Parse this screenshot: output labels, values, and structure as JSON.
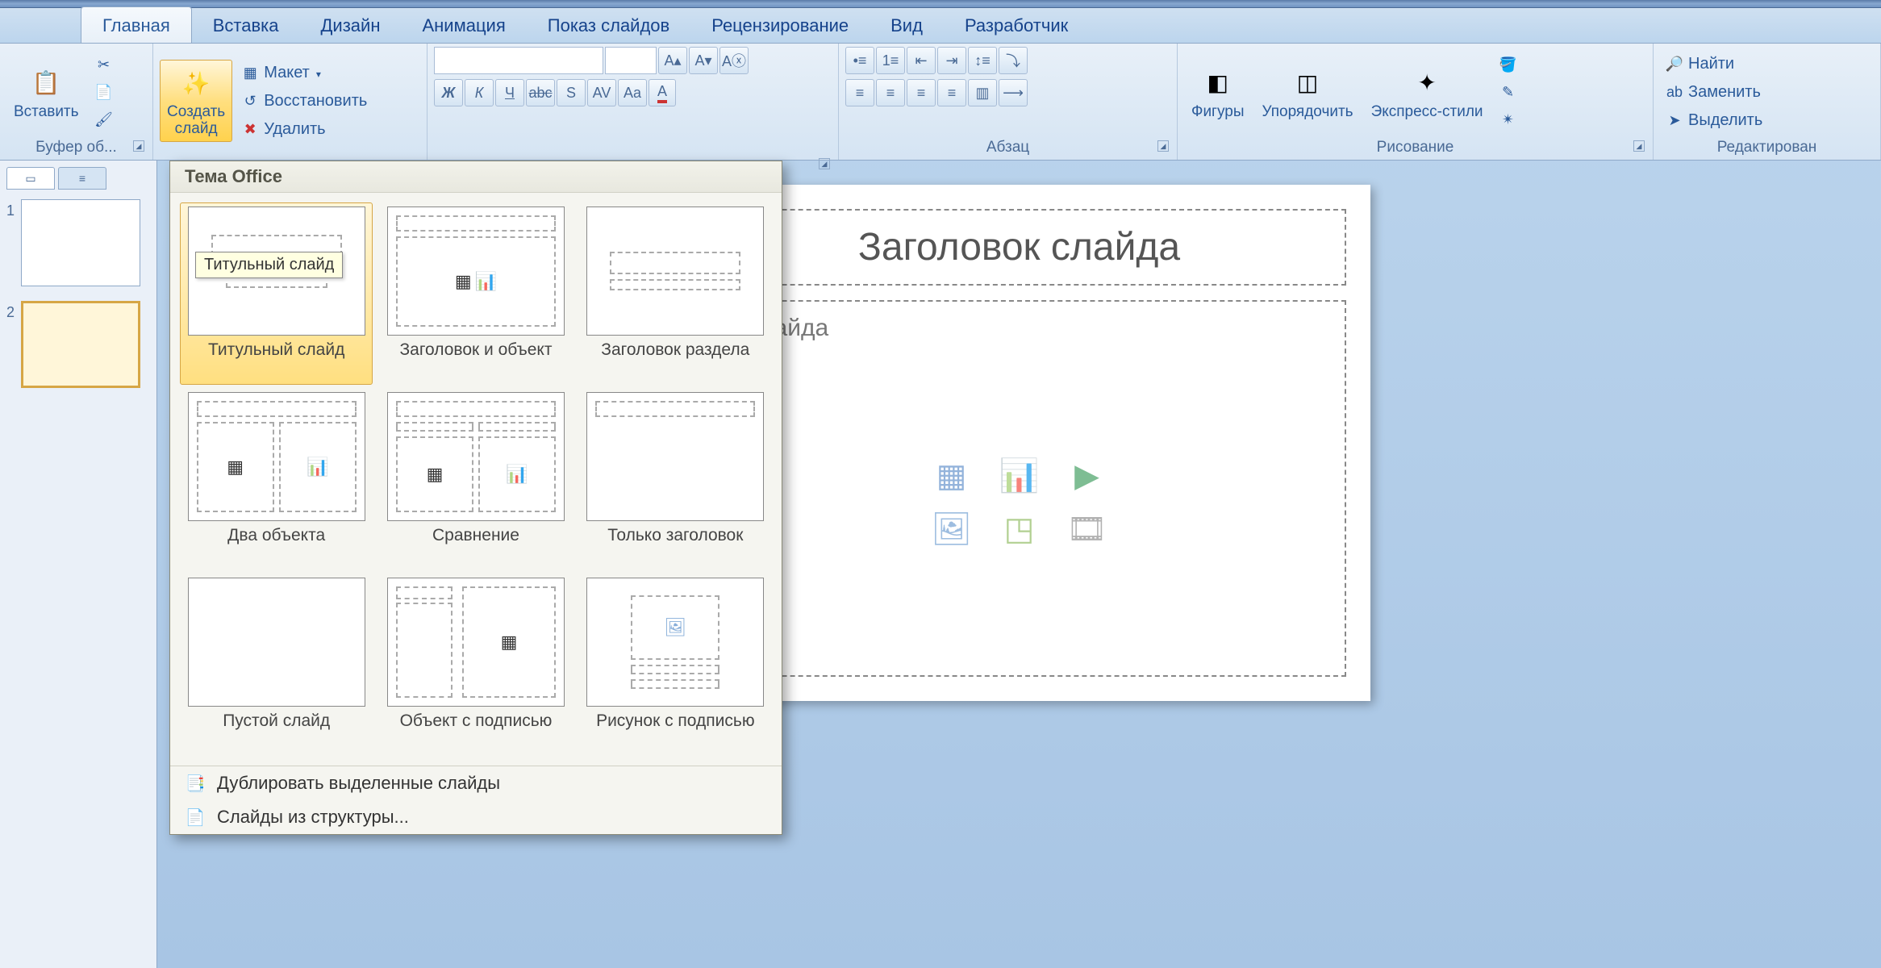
{
  "tabs": [
    "Главная",
    "Вставка",
    "Дизайн",
    "Анимация",
    "Показ слайдов",
    "Рецензирование",
    "Вид",
    "Разработчик"
  ],
  "active_tab": "Главная",
  "groups": {
    "clipboard": {
      "paste": "Вставить",
      "label": "Буфер об..."
    },
    "slides": {
      "new_slide": "Создать\nслайд",
      "layout": "Макет",
      "reset": "Восстановить",
      "delete": "Удалить"
    },
    "font": {
      "label": ""
    },
    "paragraph": {
      "label": "Абзац"
    },
    "drawing": {
      "shapes": "Фигуры",
      "arrange": "Упорядочить",
      "styles": "Экспресс-стили",
      "label": "Рисование"
    },
    "editing": {
      "find": "Найти",
      "replace": "Заменить",
      "select": "Выделить",
      "label": "Редактирован"
    }
  },
  "dropdown": {
    "header": "Тема Office",
    "layouts": [
      "Титульный слайд",
      "Заголовок и объект",
      "Заголовок раздела",
      "Два объекта",
      "Сравнение",
      "Только заголовок",
      "Пустой слайд",
      "Объект с подписью",
      "Рисунок с подписью"
    ],
    "tooltip": "Титульный слайд",
    "footer_items": [
      "Дублировать выделенные слайды",
      "Слайды из структуры..."
    ]
  },
  "slide": {
    "title_placeholder": "Заголовок слайда",
    "body_text": "кст слайда"
  },
  "thumbs": {
    "n1": "1",
    "n2": "2"
  }
}
